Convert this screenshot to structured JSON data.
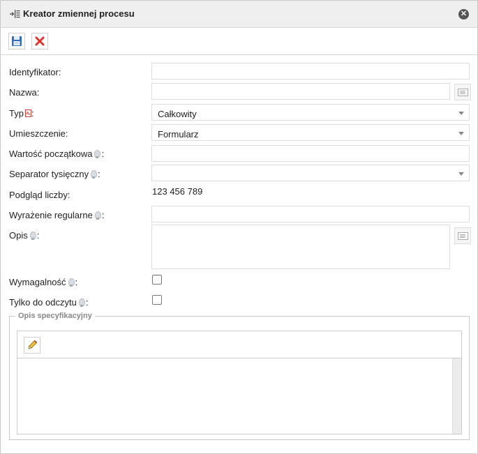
{
  "dialog": {
    "title": "Kreator zmiennej procesu",
    "close_symbol": "✕"
  },
  "toolbar": {
    "save_icon": "floppy-save-icon",
    "cancel_icon": "red-x-cancel-icon"
  },
  "form": {
    "identyfikator_label": "Identyfikator:",
    "nazwa_label": "Nazwa:",
    "typ_label": "Typ",
    "typ_label_suffix": ":",
    "typ_value": "Całkowity",
    "umieszczenie_label": "Umieszczenie:",
    "umieszczenie_value": "Formularz",
    "wartosc_label": "Wartość początkowa",
    "separator_label": "Separator tysięczny",
    "podglad_label": "Podgląd liczby:",
    "podglad_value": "123 456 789",
    "wyrazenie_label": "Wyrażenie regularne",
    "opis_label": "Opis",
    "wymagalnosc_label": "Wymagalność",
    "tylko_label": "Tylko do odczytu",
    "colon": ":"
  },
  "spec": {
    "legend": "Opis specyfikacyjny",
    "edit_icon": "pencil-icon"
  },
  "colors": {
    "title_bar": "#efefef",
    "border": "#dddddd",
    "cancel_red": "#e0302a",
    "save_blue": "#2f6fc0"
  }
}
